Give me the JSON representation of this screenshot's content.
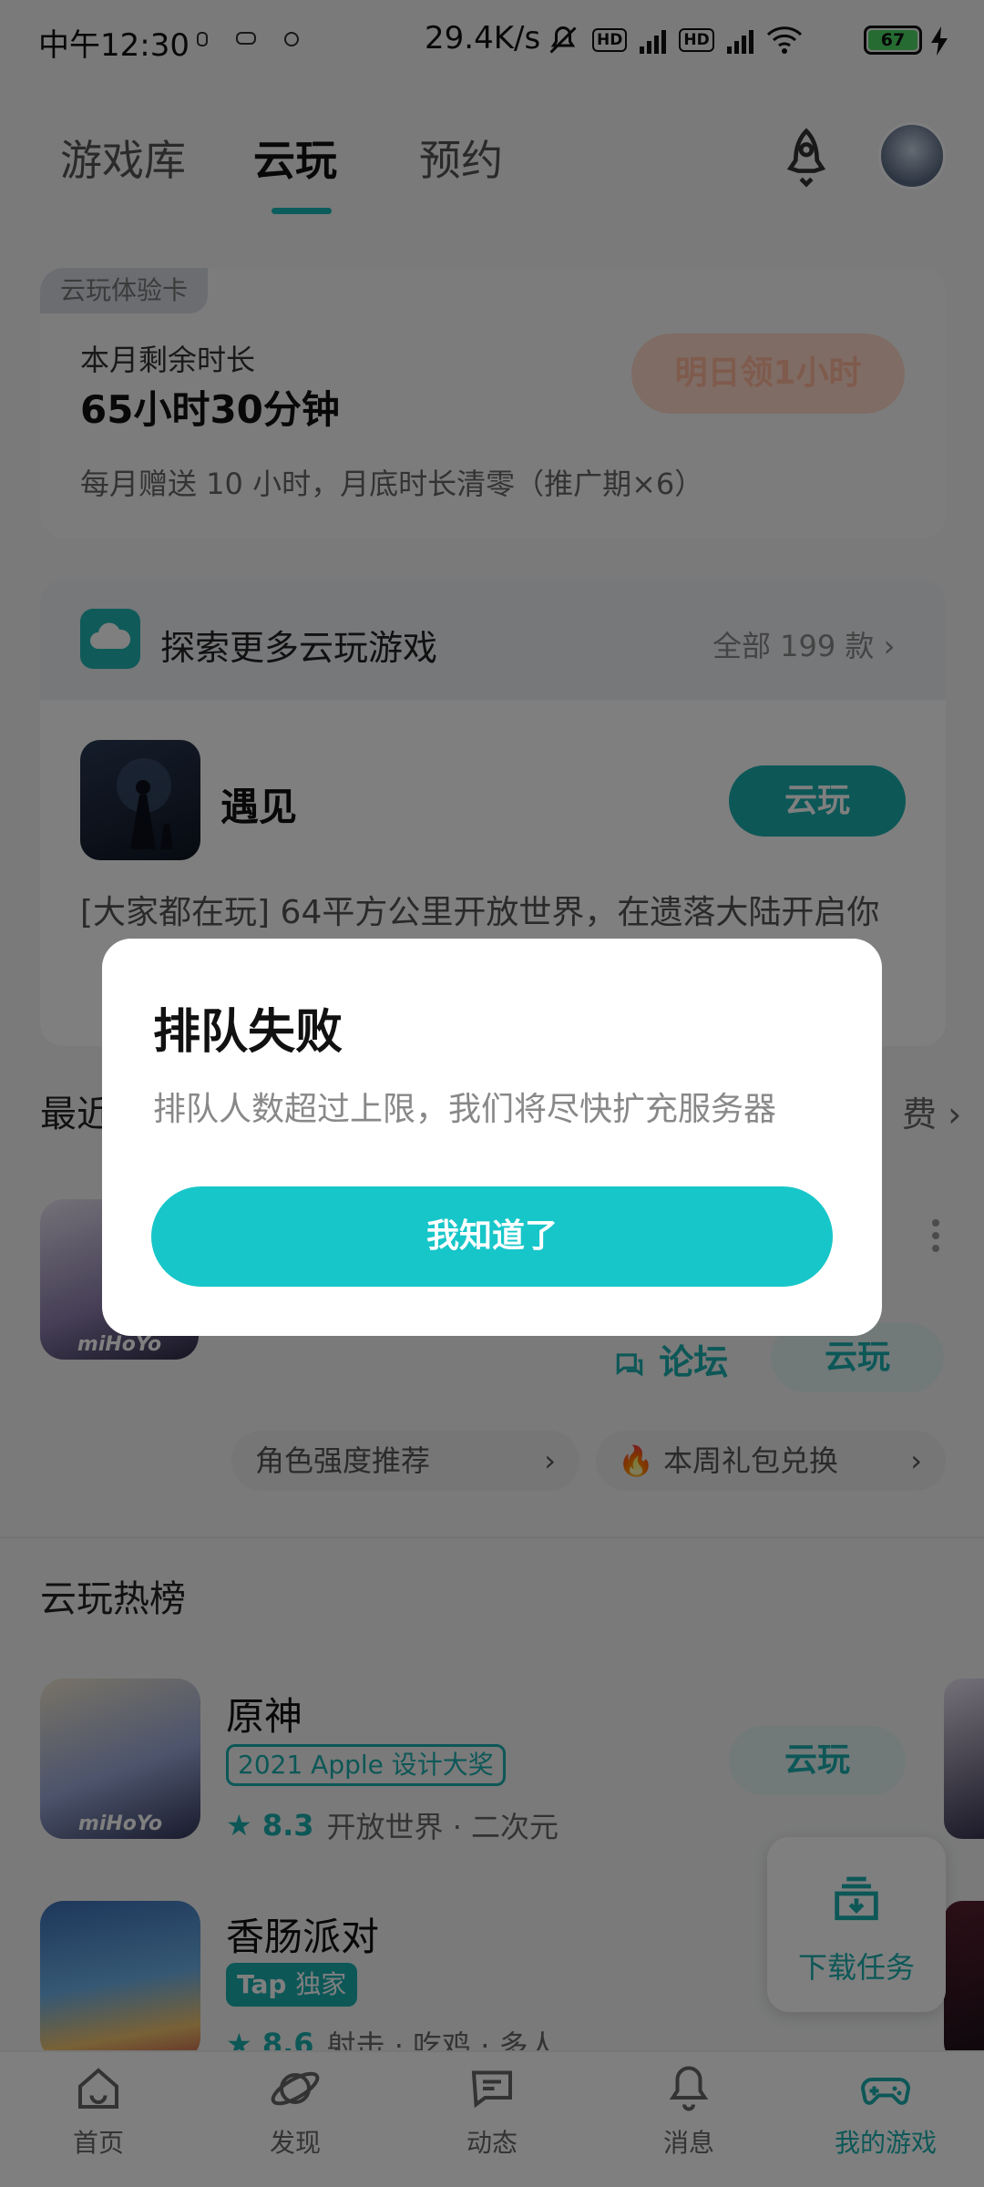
{
  "status_bar": {
    "time": "中午12:30",
    "network_speed": "29.4K/s",
    "battery": "67",
    "icons": [
      "mute-icon",
      "hd-icon",
      "signal-4g-icon",
      "wifi-icon",
      "battery-icon",
      "charging-icon"
    ]
  },
  "header": {
    "tabs": [
      {
        "label": "游戏库",
        "active": false
      },
      {
        "label": "云玩",
        "active": true
      },
      {
        "label": "预约",
        "active": false
      }
    ]
  },
  "experience_card": {
    "badge": "云玩体验卡",
    "remaining_label": "本月剩余时长",
    "remaining_value": "65小时30分钟",
    "claim_button": "明日领1小时",
    "description": "每月赠送 10 小时，月底时长清零（推广期×6）"
  },
  "explore_card": {
    "title": "探索更多云玩游戏",
    "all_link": "全部 199 款",
    "game_name": "遇见",
    "play_button": "云玩",
    "description": "[大家都在玩] 64平方公里开放世界，在遗落大陆开启你"
  },
  "recent": {
    "title": "最近",
    "right_text": "费",
    "forum_button": "论坛",
    "play_button": "云玩",
    "chips": [
      "角色强度推荐",
      "本周礼包兑换"
    ]
  },
  "hot_list": {
    "title": "云玩热榜",
    "items": [
      {
        "name": "原神",
        "badge": "2021 Apple 设计大奖",
        "rating": "8.3",
        "tags": "开放世界 · 二次元",
        "play": "云玩"
      },
      {
        "name": "香肠派对",
        "badge_brand": "Tap",
        "badge_text": "独家",
        "rating": "8.6",
        "tags": "射击 · 吃鸡 · 多人"
      }
    ]
  },
  "download_task": {
    "label": "下载任务"
  },
  "bottom_nav": [
    {
      "label": "首页",
      "icon": "home-icon"
    },
    {
      "label": "发现",
      "icon": "planet-icon"
    },
    {
      "label": "动态",
      "icon": "chat-icon"
    },
    {
      "label": "消息",
      "icon": "bell-icon"
    },
    {
      "label": "我的游戏",
      "icon": "gamepad-icon",
      "active": true
    }
  ],
  "dialog": {
    "title": "排队失败",
    "message": "排队人数超过上限，我们将尽快扩充服务器",
    "confirm_button": "我知道了"
  },
  "colors": {
    "accent": "#17c6c9",
    "teal": "#1aaeae",
    "overlay": "rgba(0,0,0,0.5)"
  }
}
